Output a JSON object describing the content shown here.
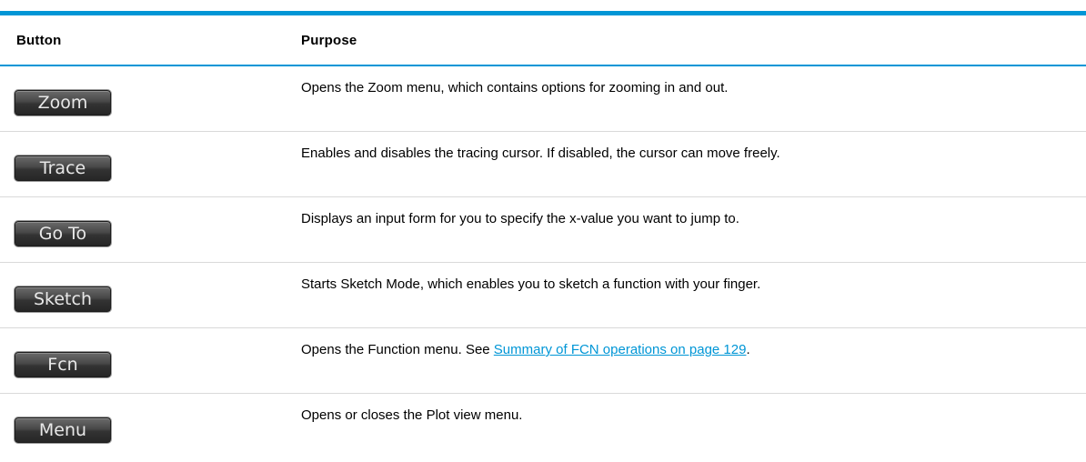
{
  "colors": {
    "accent_rule": "#0096d6",
    "link": "#0096d6",
    "row_rule": "#d9d9d9",
    "header_rule": "#0096d6"
  },
  "table": {
    "headers": {
      "button": "Button",
      "purpose": "Purpose"
    },
    "rows": [
      {
        "button_label": "Zoom",
        "purpose_text": "Opens the Zoom menu, which contains options for zooming in and out."
      },
      {
        "button_label": "Trace",
        "purpose_text": "Enables and disables the tracing cursor. If disabled, the cursor can move freely."
      },
      {
        "button_label": "Go To",
        "purpose_text": "Displays an input form for you to specify the x-value you want to jump to."
      },
      {
        "button_label": "Sketch",
        "purpose_text": "Starts Sketch Mode, which enables you to sketch a function with your finger."
      },
      {
        "button_label": "Fcn",
        "purpose_prefix": "Opens the Function menu. See ",
        "purpose_link": "Summary of FCN operations on page 129",
        "purpose_suffix": "."
      },
      {
        "button_label": "Menu",
        "purpose_text": "Opens or closes the Plot view menu."
      }
    ]
  }
}
